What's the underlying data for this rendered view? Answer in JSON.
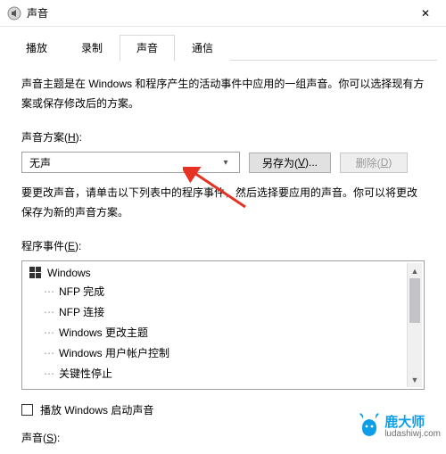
{
  "window": {
    "title": "声音",
    "close": "✕"
  },
  "tabs": {
    "items": [
      {
        "label": "播放"
      },
      {
        "label": "录制"
      },
      {
        "label": "声音"
      },
      {
        "label": "通信"
      }
    ],
    "active_index": 2
  },
  "intro": "声音主题是在 Windows 和程序产生的活动事件中应用的一组声音。你可以选择现有方案或保存修改后的方案。",
  "scheme": {
    "label_prefix": "声音方案(",
    "label_hotkey": "H",
    "label_suffix": "):",
    "selected": "无声",
    "save_as_prefix": "另存为(",
    "save_as_hotkey": "V",
    "save_as_suffix": ")...",
    "delete_prefix": "删除(",
    "delete_hotkey": "D",
    "delete_suffix": ")"
  },
  "desc2": "要更改声音，请单击以下列表中的程序事件，然后选择要应用的声音。你可以将更改保存为新的声音方案。",
  "events": {
    "label_prefix": "程序事件(",
    "label_hotkey": "E",
    "label_suffix": "):",
    "root": "Windows",
    "items": [
      "NFP 完成",
      "NFP 连接",
      "Windows 更改主题",
      "Windows 用户帐户控制",
      "关键性停止"
    ]
  },
  "play_startup": {
    "label": "播放 Windows 启动声音"
  },
  "sound_row": {
    "label_prefix": "声音(",
    "label_hotkey": "S",
    "label_suffix": "):"
  },
  "watermark": {
    "brand": "鹿大师",
    "url": "ludashiwj.com"
  }
}
